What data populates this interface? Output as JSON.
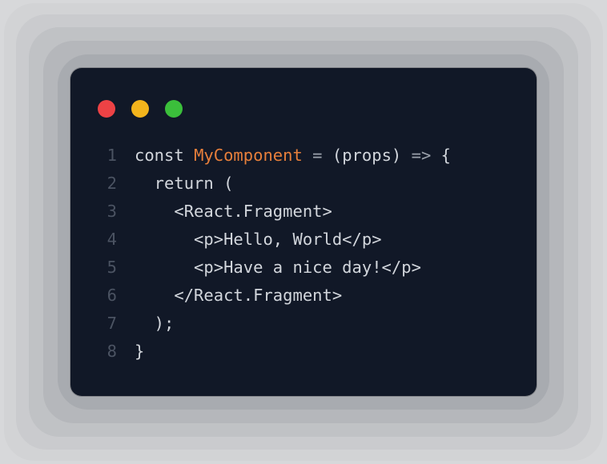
{
  "window": {
    "traffic_light_colors": {
      "red": "#ed4245",
      "yellow": "#f3b41c",
      "green": "#3bbf3b"
    }
  },
  "code": {
    "lines": [
      {
        "n": "1",
        "tokens": [
          {
            "t": "const ",
            "c": "tok-k"
          },
          {
            "t": "MyComponent",
            "c": "tok-id"
          },
          {
            "t": " ",
            "c": "tok-n"
          },
          {
            "t": "=",
            "c": "tok-op"
          },
          {
            "t": " (props) ",
            "c": "tok-n"
          },
          {
            "t": "=>",
            "c": "tok-op"
          },
          {
            "t": " {",
            "c": "tok-n"
          }
        ]
      },
      {
        "n": "2",
        "tokens": [
          {
            "t": "  return (",
            "c": "tok-n"
          }
        ]
      },
      {
        "n": "3",
        "tokens": [
          {
            "t": "    <React.Fragment>",
            "c": "tok-n"
          }
        ]
      },
      {
        "n": "4",
        "tokens": [
          {
            "t": "      <p>Hello, World</p>",
            "c": "tok-n"
          }
        ]
      },
      {
        "n": "5",
        "tokens": [
          {
            "t": "      <p>Have a nice day!</p>",
            "c": "tok-n"
          }
        ]
      },
      {
        "n": "6",
        "tokens": [
          {
            "t": "    </React.Fragment>",
            "c": "tok-n"
          }
        ]
      },
      {
        "n": "7",
        "tokens": [
          {
            "t": "  );",
            "c": "tok-n"
          }
        ]
      },
      {
        "n": "8",
        "tokens": [
          {
            "t": "}",
            "c": "tok-n"
          }
        ]
      }
    ]
  }
}
